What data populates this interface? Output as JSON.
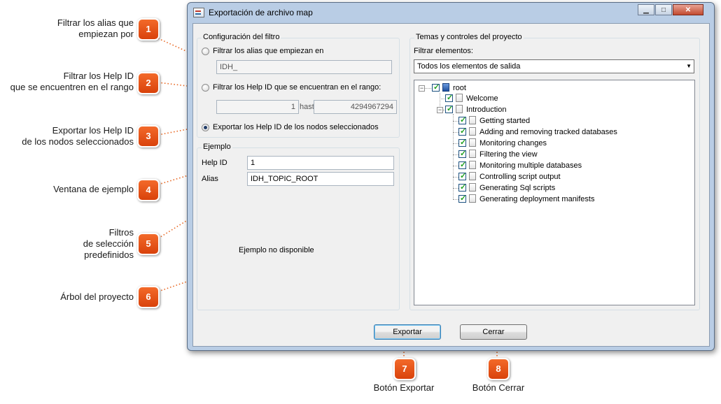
{
  "window": {
    "title": "Exportación de archivo map",
    "minimize": "▁",
    "maximize": "□",
    "close": "✕"
  },
  "filter_group": {
    "title": "Configuración del filtro",
    "option_prefix": "Filtrar los alias que empiezan en",
    "prefix_value": "IDH_",
    "option_range": "Filtrar los Help ID que se encuentran en el rango:",
    "range_from": "1",
    "range_to_label": "hast",
    "range_to": "4294967294",
    "option_selected": "Exportar los Help ID de los nodos seleccionados"
  },
  "example_group": {
    "title": "Ejemplo",
    "help_id_label": "Help ID",
    "help_id_value": "1",
    "alias_label": "Alias",
    "alias_value": "IDH_TOPIC_ROOT",
    "unavailable": "Ejemplo no disponible"
  },
  "topics_group": {
    "title": "Temas y controles del proyecto",
    "filter_label": "Filtrar elementos:",
    "filter_value": "Todos los elementos de salida",
    "tree": [
      {
        "label": "root"
      },
      {
        "label": "Welcome"
      },
      {
        "label": "Introduction"
      },
      {
        "label": "Getting started"
      },
      {
        "label": "Adding and removing tracked databases"
      },
      {
        "label": "Monitoring changes"
      },
      {
        "label": "Filtering the view"
      },
      {
        "label": "Monitoring multiple databases"
      },
      {
        "label": "Controlling script output"
      },
      {
        "label": "Generating Sql scripts"
      },
      {
        "label": "Generating deployment manifests"
      }
    ]
  },
  "buttons": {
    "export": "Exportar",
    "close": "Cerrar"
  },
  "annotations": [
    {
      "num": "1",
      "text": "Filtrar los alias que\nempiezan por"
    },
    {
      "num": "2",
      "text": "Filtrar los Help ID\nque se encuentren en el rango"
    },
    {
      "num": "3",
      "text": "Exportar los Help ID\nde los nodos seleccionados"
    },
    {
      "num": "4",
      "text": "Ventana de ejemplo"
    },
    {
      "num": "5",
      "text": "Filtros\nde selección\npredefinidos"
    },
    {
      "num": "6",
      "text": "Árbol del proyecto"
    },
    {
      "num": "7",
      "text": "Botón Exportar"
    },
    {
      "num": "8",
      "text": "Botón Cerrar"
    }
  ]
}
